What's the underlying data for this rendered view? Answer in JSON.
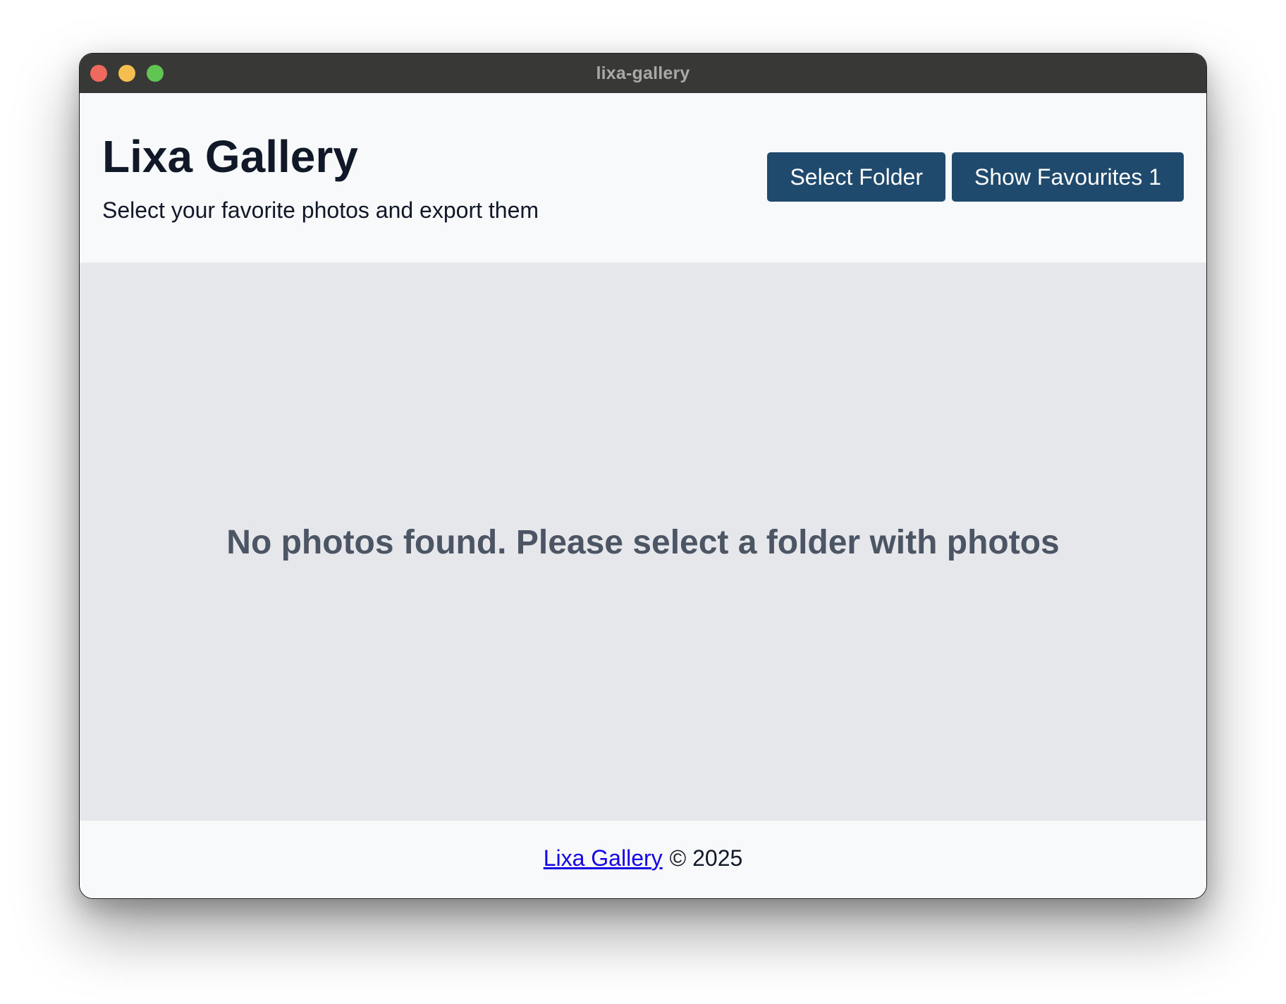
{
  "window": {
    "title": "lixa-gallery"
  },
  "header": {
    "title": "Lixa Gallery",
    "subtitle": "Select your favorite photos and export them",
    "select_folder_label": "Select Folder",
    "show_favourites_label": "Show Favourites 1"
  },
  "main": {
    "empty_message": "No photos found. Please select a folder with photos"
  },
  "footer": {
    "link_text": "Lixa Gallery",
    "copyright": "© 2025"
  },
  "colors": {
    "button_bg": "#1f4a6d",
    "titlebar_bg": "#383836",
    "main_bg": "#e5e7eb",
    "link": "#1400e6"
  }
}
